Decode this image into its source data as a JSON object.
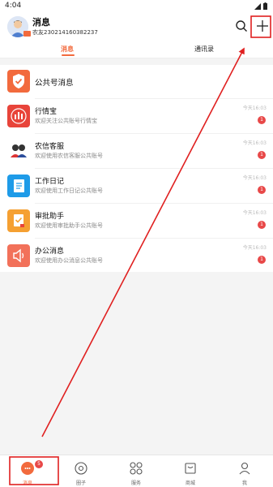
{
  "status_bar": {
    "time": "4:04"
  },
  "header": {
    "title": "消息",
    "user_id": "农友230214160382237",
    "search_icon": "search-icon",
    "add_icon": "plus-icon"
  },
  "tabs": [
    {
      "label": "消息",
      "active": true
    },
    {
      "label": "通讯录",
      "active": false
    }
  ],
  "messages": [
    {
      "title": "公共号消息",
      "subtitle": "",
      "time": "",
      "badge": "",
      "icon": "verified-account-icon",
      "color": "#f26a3d"
    },
    {
      "title": "行情宝",
      "subtitle": "欢迎关注公共账号行情宝",
      "time": "今天16:03",
      "badge": "1",
      "icon": "market-chart-icon",
      "color": "#e8443a"
    },
    {
      "title": "农信客服",
      "subtitle": "欢迎使用农信客服公共账号",
      "time": "今天16:03",
      "badge": "1",
      "icon": "customer-service-icon",
      "color": "#ffffff"
    },
    {
      "title": "工作日记",
      "subtitle": "欢迎使用工作日记公共账号",
      "time": "今天16:03",
      "badge": "1",
      "icon": "notebook-icon",
      "color": "#1e9be8"
    },
    {
      "title": "审批助手",
      "subtitle": "欢迎使用审批助手公共账号",
      "time": "今天16:03",
      "badge": "1",
      "icon": "approval-icon",
      "color": "#f5a032"
    },
    {
      "title": "办公消息",
      "subtitle": "欢迎使用办公消息公共账号",
      "time": "今天16:03",
      "badge": "1",
      "icon": "speaker-icon",
      "color": "#f2715a"
    }
  ],
  "bottom_nav": [
    {
      "label": "消息",
      "badge": "5",
      "icon": "chat-bubble-icon"
    },
    {
      "label": "圈子",
      "badge": "",
      "icon": "circle-icon"
    },
    {
      "label": "服务",
      "badge": "",
      "icon": "grid-icon"
    },
    {
      "label": "商城",
      "badge": "",
      "icon": "shop-icon"
    },
    {
      "label": "我",
      "badge": "",
      "icon": "user-icon"
    }
  ],
  "colors": {
    "accent": "#f26a3d",
    "badge": "#e84848",
    "annotation": "#e02020"
  }
}
